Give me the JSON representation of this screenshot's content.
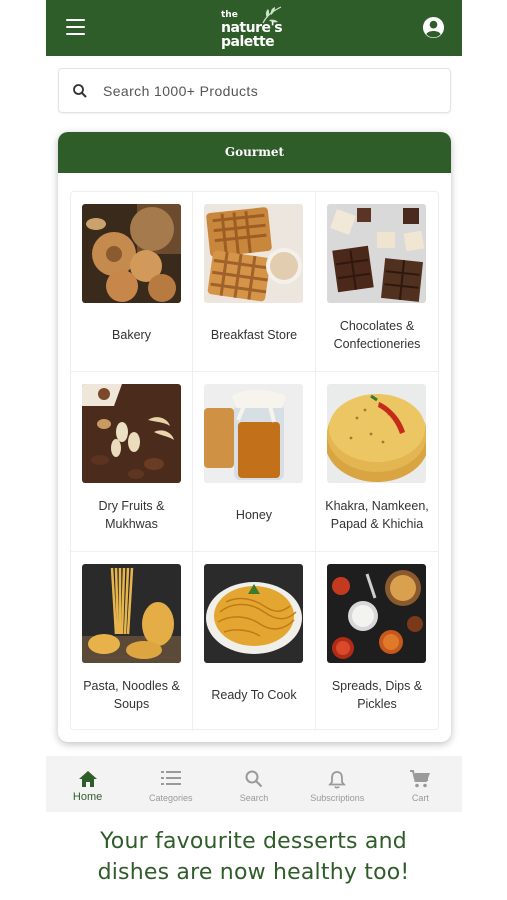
{
  "app": {
    "logo_text": [
      "the",
      "nature's",
      "palette"
    ]
  },
  "colors": {
    "brand_green": "#2f5d2a",
    "header_text": "#ffffff",
    "nav_inactive": "#9a9a9a"
  },
  "header": {
    "menu_icon": "hamburger-menu-icon",
    "account_icon": "account-circle-icon"
  },
  "search": {
    "placeholder": "Search 1000+ Products",
    "icon": "search-icon"
  },
  "section": {
    "title": "Gourmet",
    "categories": [
      {
        "label": "Bakery",
        "image": "bakery-image"
      },
      {
        "label": "Breakfast Store",
        "image": "breakfast-image"
      },
      {
        "label": "Chocolates &\nConfectioneries",
        "image": "chocolates-image"
      },
      {
        "label": "Dry Fruits &\nMukhwas",
        "image": "dry-fruits-image"
      },
      {
        "label": "Honey",
        "image": "honey-image"
      },
      {
        "label": "Khakra,  Namkeen,\nPapad & Khichia",
        "image": "khakra-image"
      },
      {
        "label": "Pasta, Noodles &\nSoups",
        "image": "pasta-image"
      },
      {
        "label": "Ready To Cook",
        "image": "ready-to-cook-image"
      },
      {
        "label": "Spreads, Dips &\nPickles",
        "image": "spreads-image"
      }
    ]
  },
  "bottom_nav": [
    {
      "label": "Home",
      "icon": "home-icon",
      "active": true
    },
    {
      "label": "Categories",
      "icon": "list-icon",
      "active": false
    },
    {
      "label": "Search",
      "icon": "search-icon",
      "active": false
    },
    {
      "label": "Subscriptions",
      "icon": "bell-icon",
      "active": false
    },
    {
      "label": "Cart",
      "icon": "cart-icon",
      "active": false
    }
  ],
  "tagline": "Your favourite desserts and\ndishes are now healthy too!"
}
